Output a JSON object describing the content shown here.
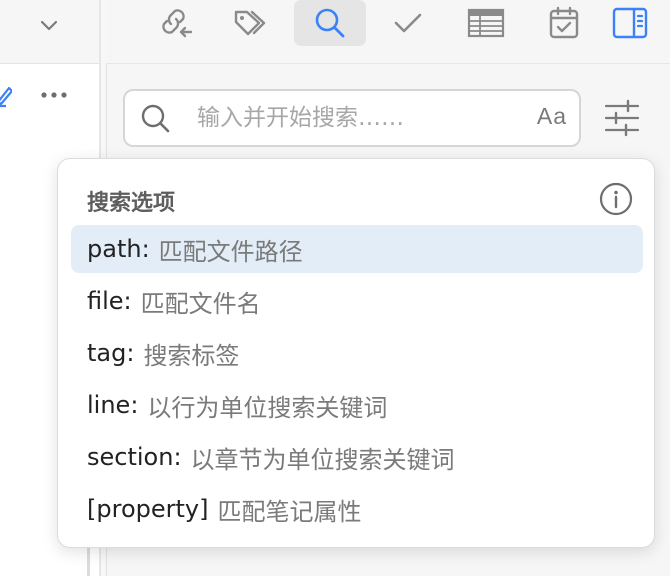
{
  "search": {
    "placeholder": "输入并开始搜索……",
    "value": "",
    "match_case_label": "Aa"
  },
  "popup": {
    "title": "搜索选项",
    "options": [
      {
        "key": "path:",
        "desc": "匹配文件路径"
      },
      {
        "key": "file:",
        "desc": "匹配文件名"
      },
      {
        "key": "tag:",
        "desc": "搜索标签"
      },
      {
        "key": "line:",
        "desc": "以行为单位搜索关键词"
      },
      {
        "key": "section:",
        "desc": "以章节为单位搜索关键词"
      },
      {
        "key": "[property]",
        "desc": "匹配笔记属性"
      }
    ],
    "selected_index": 0
  },
  "toolbar_icons": [
    "backlinks-icon",
    "tags-icon",
    "search-icon",
    "checkmark-icon",
    "table-icon",
    "calendar-icon",
    "sidebar-toggle-icon"
  ],
  "colors": {
    "accent": "#3b82f6",
    "icon_gray": "#8a8a8a",
    "selected_bg": "#e3edf7"
  }
}
